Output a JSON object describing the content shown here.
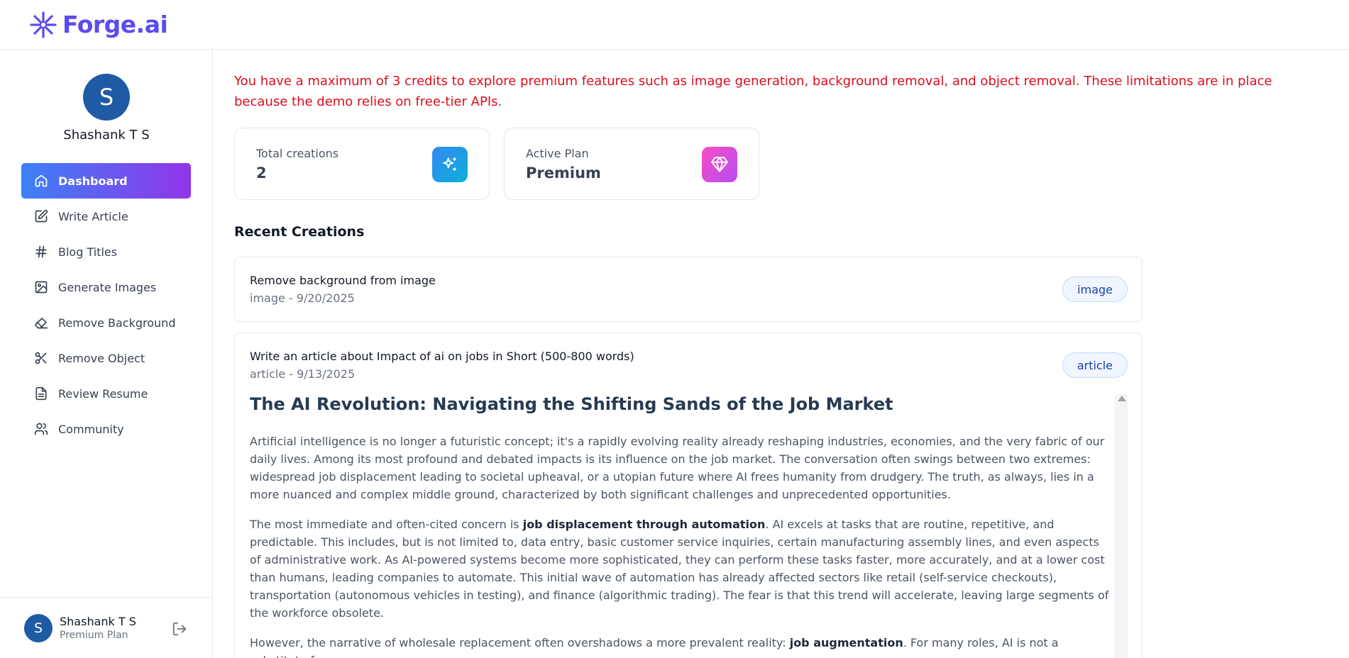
{
  "app": {
    "brand": "Forge.ai"
  },
  "sidebar": {
    "user": {
      "initial": "S",
      "name": "Shashank T S"
    },
    "items": [
      {
        "label": "Dashboard",
        "icon": "home-icon"
      },
      {
        "label": "Write Article",
        "icon": "edit-icon"
      },
      {
        "label": "Blog Titles",
        "icon": "hash-icon"
      },
      {
        "label": "Generate Images",
        "icon": "image-icon"
      },
      {
        "label": "Remove Background",
        "icon": "eraser-icon"
      },
      {
        "label": "Remove Object",
        "icon": "scissors-icon"
      },
      {
        "label": "Review Resume",
        "icon": "file-text-icon"
      },
      {
        "label": "Community",
        "icon": "users-icon"
      }
    ],
    "active_index": 0,
    "footer": {
      "initial": "S",
      "name": "Shashank T S",
      "plan": "Premium Plan"
    }
  },
  "main": {
    "notice": "You have a maximum of 3 credits to explore premium features such as image generation, background removal, and object removal. These limitations are in place because the demo relies on free-tier APIs.",
    "stats": [
      {
        "label": "Total creations",
        "value": "2",
        "icon": "sparkles-icon",
        "color_from": "#3588f2",
        "color_to": "#0bb0d7"
      },
      {
        "label": "Active Plan",
        "value": "Premium",
        "icon": "gem-icon",
        "color_from": "#f64ec3",
        "color_to": "#b74cf3"
      }
    ],
    "recent_title": "Recent Creations",
    "creations": [
      {
        "prompt": "Remove background from image",
        "meta": "image - 9/20/2025",
        "tag": "image"
      },
      {
        "prompt": "Write an article about Impact of ai on jobs in Short (500-800 words)",
        "meta": "article - 9/13/2025",
        "tag": "article",
        "content": {
          "heading": "The AI Revolution: Navigating the Shifting Sands of the Job Market",
          "p1": "Artificial intelligence is no longer a futuristic concept; it's a rapidly evolving reality already reshaping industries, economies, and the very fabric of our daily lives. Among its most profound and debated impacts is its influence on the job market. The conversation often swings between two extremes: widespread job displacement leading to societal upheaval, or a utopian future where AI frees humanity from drudgery. The truth, as always, lies in a more nuanced and complex middle ground, characterized by both significant challenges and unprecedented opportunities.",
          "p2_pre": "The most immediate and often-cited concern is ",
          "p2_bold": "job displacement through automation",
          "p2_post": ". AI excels at tasks that are routine, repetitive, and predictable. This includes, but is not limited to, data entry, basic customer service inquiries, certain manufacturing assembly lines, and even aspects of administrative work. As AI-powered systems become more sophisticated, they can perform these tasks faster, more accurately, and at a lower cost than humans, leading companies to automate. This initial wave of automation has already affected sectors like retail (self-service checkouts), transportation (autonomous vehicles in testing), and finance (algorithmic trading). The fear is that this trend will accelerate, leaving large segments of the workforce obsolete.",
          "p3_pre": "However, the narrative of wholesale replacement often overshadows a more prevalent reality: ",
          "p3_bold": "job augmentation",
          "p3_post": ". For many roles, AI is not a substitute for"
        }
      }
    ]
  },
  "colors": {
    "brand": "#5b4cf0",
    "notice": "#dc0d1f",
    "active_from": "#3c81f6",
    "active_to": "#9234ea",
    "avatar": "#1f5aa5"
  }
}
